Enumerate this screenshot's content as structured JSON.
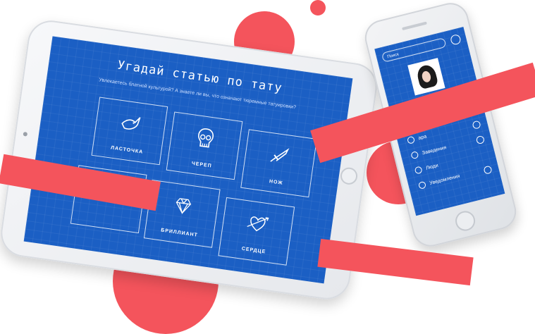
{
  "colors": {
    "accent": "#f4545c",
    "screen_blue": "#1b5fc4",
    "device_silver": "#e6e8ec"
  },
  "tablet": {
    "title": "Угадай статью по тату",
    "subtitle": "Увлекаетесь блатной культурой? А знаете ли вы, что означают тюремные татуировки?",
    "cards": [
      {
        "label": "ЛАСТОЧКА",
        "icon": "swallow-icon"
      },
      {
        "label": "ЧЕРЕП",
        "icon": "skull-icon"
      },
      {
        "label": "НОЖ",
        "icon": "knife-icon"
      },
      {
        "label": "",
        "icon": "unknown-icon"
      },
      {
        "label": "БРИЛЛИАНТ",
        "icon": "diamond-icon"
      },
      {
        "label": "СЕРДЦЕ",
        "icon": "heart-arrow-icon"
      }
    ]
  },
  "phone": {
    "search_placeholder": "Поиск",
    "menu": [
      {
        "label": "ара"
      },
      {
        "label": "Заведения"
      },
      {
        "label": "Люди"
      },
      {
        "label": "Уведомления"
      }
    ]
  }
}
